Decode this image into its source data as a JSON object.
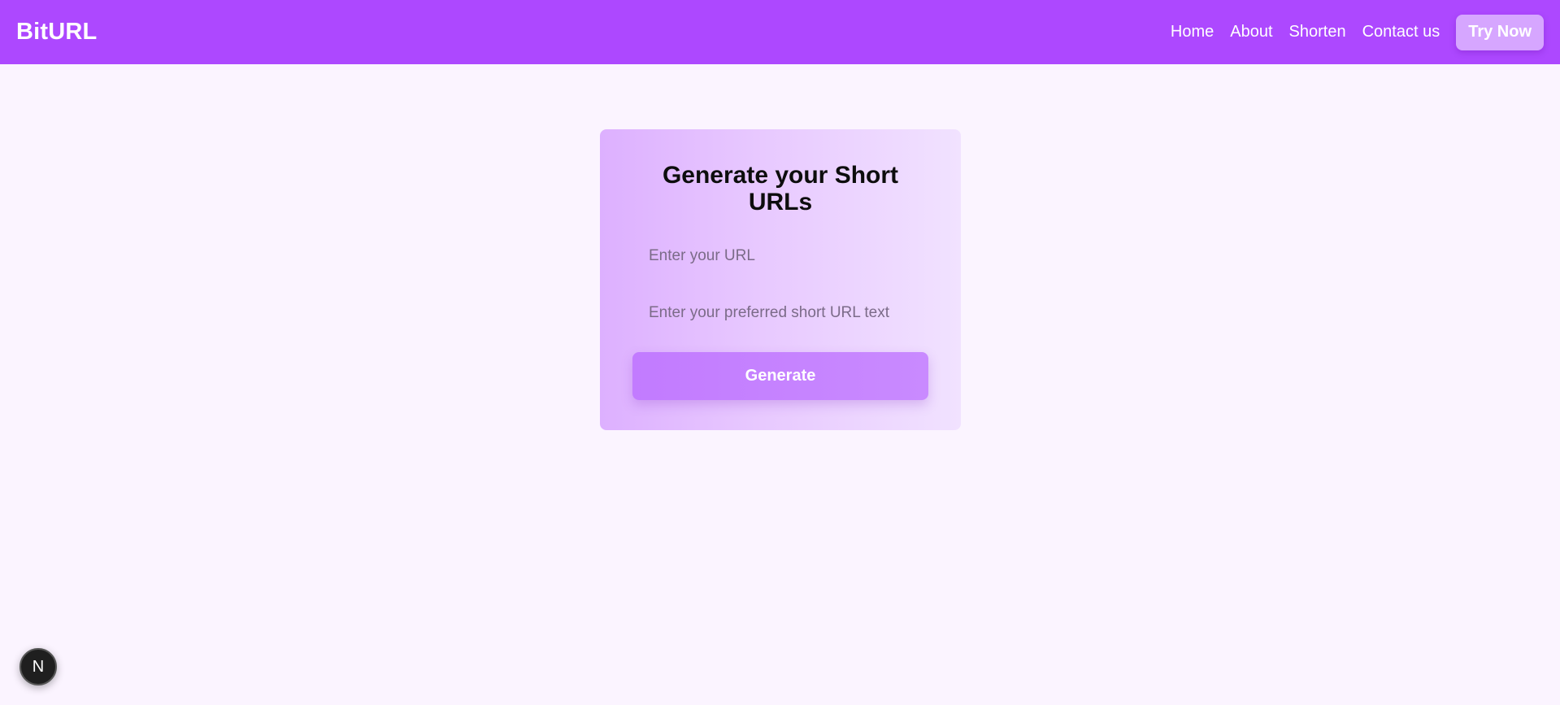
{
  "navbar": {
    "brand": "BitURL",
    "links": [
      "Home",
      "About",
      "Shorten",
      "Contact us"
    ],
    "cta_label": "Try Now"
  },
  "card": {
    "title": "Generate your Short URLs",
    "url_placeholder": "Enter your URL",
    "short_placeholder": "Enter your preferred short URL text",
    "url_value": "",
    "short_value": "",
    "button_label": "Generate"
  },
  "dev_badge": {
    "icon": "nextjs-logo-icon",
    "letter": "N"
  },
  "colors": {
    "navbar": "#ad48ff",
    "page_background": "#fbf4ff",
    "cta_button": "#d6a6ff",
    "generate_button": "#c27bff"
  }
}
